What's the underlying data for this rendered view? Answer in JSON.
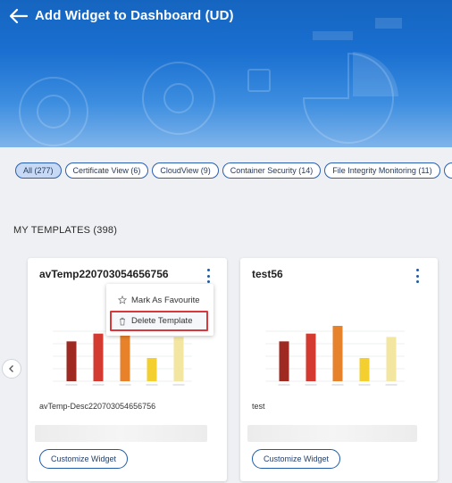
{
  "header": {
    "title": "Add Widget to Dashboard (UD)",
    "back_icon": "arrow-left-icon"
  },
  "filters": [
    {
      "label": "All (277)",
      "active": true
    },
    {
      "label": "Certificate View (6)",
      "active": false
    },
    {
      "label": "CloudView (9)",
      "active": false
    },
    {
      "label": "Container Security (14)",
      "active": false
    },
    {
      "label": "File Integrity Monitoring (11)",
      "active": false
    },
    {
      "label": "",
      "active": false
    }
  ],
  "section": {
    "title": "MY TEMPLATES (398)"
  },
  "cards": [
    {
      "title": "avTemp220703054656756",
      "description": "avTemp-Desc220703054656756",
      "button": "Customize Widget",
      "chart_data": {
        "type": "bar",
        "categories": [
          "",
          "",
          "",
          "",
          ""
        ],
        "values": [
          0.72,
          0.86,
          0.9,
          0.42,
          0.8
        ],
        "colors": [
          "#9e2a22",
          "#d43a30",
          "#e8822a",
          "#f3d030",
          "#f3e6a0"
        ]
      }
    },
    {
      "title": "test56",
      "description": "test",
      "button": "Customize Widget",
      "chart_data": {
        "type": "bar",
        "categories": [
          "",
          "",
          "",
          "",
          ""
        ],
        "values": [
          0.72,
          0.86,
          1.0,
          0.42,
          0.8
        ],
        "colors": [
          "#9e2a22",
          "#d43a30",
          "#e8822a",
          "#f3d030",
          "#f3e6a0"
        ]
      }
    }
  ],
  "context_menu": {
    "items": [
      {
        "label": "Mark As Favourite",
        "icon": "star-icon"
      },
      {
        "label": "Delete Template",
        "icon": "trash-icon"
      }
    ]
  },
  "colors": {
    "accent": "#1f5ba8",
    "highlight_border": "#d9373b"
  }
}
